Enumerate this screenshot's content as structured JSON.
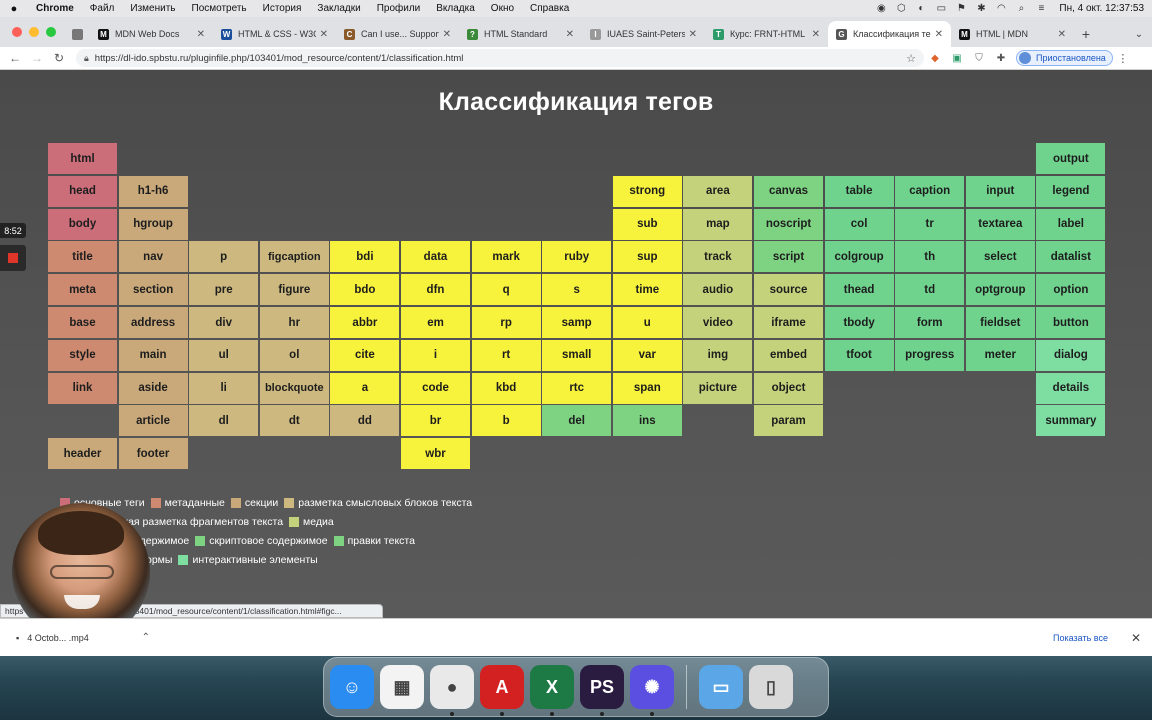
{
  "menubar": {
    "app": "Chrome",
    "items": [
      "Файл",
      "Изменить",
      "Посмотреть",
      "История",
      "Закладки",
      "Профили",
      "Вкладка",
      "Окно",
      "Справка"
    ],
    "clock": "Пн, 4 окт.  12:37:53"
  },
  "tabs": [
    {
      "label": "",
      "fav": "",
      "color": "#777",
      "pinned": true
    },
    {
      "label": "MDN Web Docs",
      "fav": "M",
      "color": "#111"
    },
    {
      "label": "HTML & CSS - W3C",
      "fav": "W",
      "color": "#1a4f9c"
    },
    {
      "label": "Can I use... Support",
      "fav": "C",
      "color": "#8a5a2b"
    },
    {
      "label": "HTML Standard",
      "fav": "?",
      "color": "#3a8a3a"
    },
    {
      "label": "IUAES Saint-Petersb",
      "fav": "I",
      "color": "#999"
    },
    {
      "label": "Курс: FRNT-HTML",
      "fav": "T",
      "color": "#2d9c6a"
    },
    {
      "label": "Классификация тег",
      "fav": "G",
      "color": "#555",
      "active": true
    },
    {
      "label": "HTML | MDN",
      "fav": "M",
      "color": "#111"
    }
  ],
  "toolbar": {
    "url": "https://dl-ido.spbstu.ru/pluginfile.php/103401/mod_resource/content/1/classification.html",
    "paused_label": "Приостановлена"
  },
  "page": {
    "title": "Классификация тегов"
  },
  "colors": {
    "basic": "#cc6e7a",
    "meta": "#cd8a70",
    "sections": "#c9a97a",
    "grouping": "#cdb97f",
    "text": "#f7f23b",
    "media": "#c4d37b",
    "edits": "#7ed383",
    "script": "#7ed383",
    "tables": "#6fd38e",
    "forms": "#6fd38e",
    "interactive": "#7edea2"
  },
  "cells": [
    {
      "tag": "html",
      "cat": "basic",
      "col": 0,
      "row": 0
    },
    {
      "tag": "head",
      "cat": "basic",
      "col": 0,
      "row": 1
    },
    {
      "tag": "body",
      "cat": "basic",
      "col": 0,
      "row": 2
    },
    {
      "tag": "title",
      "cat": "meta",
      "col": 0,
      "row": 3
    },
    {
      "tag": "meta",
      "cat": "meta",
      "col": 0,
      "row": 4
    },
    {
      "tag": "base",
      "cat": "meta",
      "col": 0,
      "row": 5
    },
    {
      "tag": "style",
      "cat": "meta",
      "col": 0,
      "row": 6
    },
    {
      "tag": "link",
      "cat": "meta",
      "col": 0,
      "row": 7
    },
    {
      "tag": "header",
      "cat": "sections",
      "col": 0,
      "row": 9
    },
    {
      "tag": "h1-h6",
      "cat": "sections",
      "col": 1,
      "row": 1
    },
    {
      "tag": "hgroup",
      "cat": "sections",
      "col": 1,
      "row": 2
    },
    {
      "tag": "nav",
      "cat": "sections",
      "col": 1,
      "row": 3
    },
    {
      "tag": "section",
      "cat": "sections",
      "col": 1,
      "row": 4
    },
    {
      "tag": "address",
      "cat": "sections",
      "col": 1,
      "row": 5
    },
    {
      "tag": "main",
      "cat": "sections",
      "col": 1,
      "row": 6
    },
    {
      "tag": "aside",
      "cat": "sections",
      "col": 1,
      "row": 7
    },
    {
      "tag": "article",
      "cat": "sections",
      "col": 1,
      "row": 8
    },
    {
      "tag": "footer",
      "cat": "sections",
      "col": 1,
      "row": 9
    },
    {
      "tag": "p",
      "cat": "grouping",
      "col": 2,
      "row": 3
    },
    {
      "tag": "pre",
      "cat": "grouping",
      "col": 2,
      "row": 4
    },
    {
      "tag": "div",
      "cat": "grouping",
      "col": 2,
      "row": 5
    },
    {
      "tag": "ul",
      "cat": "grouping",
      "col": 2,
      "row": 6
    },
    {
      "tag": "li",
      "cat": "grouping",
      "col": 2,
      "row": 7
    },
    {
      "tag": "dl",
      "cat": "grouping",
      "col": 2,
      "row": 8
    },
    {
      "tag": "figcaption",
      "cat": "grouping",
      "col": 3,
      "row": 3
    },
    {
      "tag": "figure",
      "cat": "grouping",
      "col": 3,
      "row": 4
    },
    {
      "tag": "hr",
      "cat": "grouping",
      "col": 3,
      "row": 5
    },
    {
      "tag": "ol",
      "cat": "grouping",
      "col": 3,
      "row": 6
    },
    {
      "tag": "blockquote",
      "cat": "grouping",
      "col": 3,
      "row": 7
    },
    {
      "tag": "dt",
      "cat": "grouping",
      "col": 3,
      "row": 8
    },
    {
      "tag": "bdi",
      "cat": "text",
      "col": 4,
      "row": 3
    },
    {
      "tag": "bdo",
      "cat": "text",
      "col": 4,
      "row": 4
    },
    {
      "tag": "abbr",
      "cat": "text",
      "col": 4,
      "row": 5
    },
    {
      "tag": "cite",
      "cat": "text",
      "col": 4,
      "row": 6
    },
    {
      "tag": "a",
      "cat": "text",
      "col": 4,
      "row": 7
    },
    {
      "tag": "dd",
      "cat": "grouping",
      "col": 4,
      "row": 8
    },
    {
      "tag": "data",
      "cat": "text",
      "col": 5,
      "row": 3
    },
    {
      "tag": "dfn",
      "cat": "text",
      "col": 5,
      "row": 4
    },
    {
      "tag": "em",
      "cat": "text",
      "col": 5,
      "row": 5
    },
    {
      "tag": "i",
      "cat": "text",
      "col": 5,
      "row": 6
    },
    {
      "tag": "code",
      "cat": "text",
      "col": 5,
      "row": 7
    },
    {
      "tag": "br",
      "cat": "text",
      "col": 5,
      "row": 8
    },
    {
      "tag": "wbr",
      "cat": "text",
      "col": 5,
      "row": 9
    },
    {
      "tag": "mark",
      "cat": "text",
      "col": 6,
      "row": 3
    },
    {
      "tag": "q",
      "cat": "text",
      "col": 6,
      "row": 4
    },
    {
      "tag": "rp",
      "cat": "text",
      "col": 6,
      "row": 5
    },
    {
      "tag": "rt",
      "cat": "text",
      "col": 6,
      "row": 6
    },
    {
      "tag": "kbd",
      "cat": "text",
      "col": 6,
      "row": 7
    },
    {
      "tag": "b",
      "cat": "text",
      "col": 6,
      "row": 8
    },
    {
      "tag": "ruby",
      "cat": "text",
      "col": 7,
      "row": 3
    },
    {
      "tag": "s",
      "cat": "text",
      "col": 7,
      "row": 4
    },
    {
      "tag": "samp",
      "cat": "text",
      "col": 7,
      "row": 5
    },
    {
      "tag": "small",
      "cat": "text",
      "col": 7,
      "row": 6
    },
    {
      "tag": "rtc",
      "cat": "text",
      "col": 7,
      "row": 7
    },
    {
      "tag": "del",
      "cat": "edits",
      "col": 7,
      "row": 8
    },
    {
      "tag": "strong",
      "cat": "text",
      "col": 8,
      "row": 1
    },
    {
      "tag": "sub",
      "cat": "text",
      "col": 8,
      "row": 2
    },
    {
      "tag": "sup",
      "cat": "text",
      "col": 8,
      "row": 3
    },
    {
      "tag": "time",
      "cat": "text",
      "col": 8,
      "row": 4
    },
    {
      "tag": "u",
      "cat": "text",
      "col": 8,
      "row": 5
    },
    {
      "tag": "var",
      "cat": "text",
      "col": 8,
      "row": 6
    },
    {
      "tag": "span",
      "cat": "text",
      "col": 8,
      "row": 7
    },
    {
      "tag": "ins",
      "cat": "edits",
      "col": 8,
      "row": 8
    },
    {
      "tag": "area",
      "cat": "media",
      "col": 9,
      "row": 1
    },
    {
      "tag": "map",
      "cat": "media",
      "col": 9,
      "row": 2
    },
    {
      "tag": "track",
      "cat": "media",
      "col": 9,
      "row": 3
    },
    {
      "tag": "audio",
      "cat": "media",
      "col": 9,
      "row": 4
    },
    {
      "tag": "video",
      "cat": "media",
      "col": 9,
      "row": 5
    },
    {
      "tag": "img",
      "cat": "media",
      "col": 9,
      "row": 6
    },
    {
      "tag": "picture",
      "cat": "media",
      "col": 9,
      "row": 7
    },
    {
      "tag": "canvas",
      "cat": "script",
      "col": 10,
      "row": 1
    },
    {
      "tag": "noscript",
      "cat": "script",
      "col": 10,
      "row": 2
    },
    {
      "tag": "script",
      "cat": "script",
      "col": 10,
      "row": 3
    },
    {
      "tag": "source",
      "cat": "media",
      "col": 10,
      "row": 4
    },
    {
      "tag": "iframe",
      "cat": "media",
      "col": 10,
      "row": 5
    },
    {
      "tag": "embed",
      "cat": "media",
      "col": 10,
      "row": 6
    },
    {
      "tag": "object",
      "cat": "media",
      "col": 10,
      "row": 7
    },
    {
      "tag": "param",
      "cat": "media",
      "col": 10,
      "row": 8
    },
    {
      "tag": "table",
      "cat": "tables",
      "col": 11,
      "row": 1
    },
    {
      "tag": "col",
      "cat": "tables",
      "col": 11,
      "row": 2
    },
    {
      "tag": "colgroup",
      "cat": "tables",
      "col": 11,
      "row": 3
    },
    {
      "tag": "thead",
      "cat": "tables",
      "col": 11,
      "row": 4
    },
    {
      "tag": "tbody",
      "cat": "tables",
      "col": 11,
      "row": 5
    },
    {
      "tag": "tfoot",
      "cat": "tables",
      "col": 11,
      "row": 6
    },
    {
      "tag": "caption",
      "cat": "tables",
      "col": 12,
      "row": 1
    },
    {
      "tag": "tr",
      "cat": "tables",
      "col": 12,
      "row": 2
    },
    {
      "tag": "th",
      "cat": "tables",
      "col": 12,
      "row": 3
    },
    {
      "tag": "td",
      "cat": "tables",
      "col": 12,
      "row": 4
    },
    {
      "tag": "form",
      "cat": "forms",
      "col": 12,
      "row": 5
    },
    {
      "tag": "progress",
      "cat": "forms",
      "col": 12,
      "row": 6
    },
    {
      "tag": "input",
      "cat": "forms",
      "col": 13,
      "row": 1
    },
    {
      "tag": "textarea",
      "cat": "forms",
      "col": 13,
      "row": 2
    },
    {
      "tag": "select",
      "cat": "forms",
      "col": 13,
      "row": 3
    },
    {
      "tag": "optgroup",
      "cat": "forms",
      "col": 13,
      "row": 4
    },
    {
      "tag": "fieldset",
      "cat": "forms",
      "col": 13,
      "row": 5
    },
    {
      "tag": "meter",
      "cat": "forms",
      "col": 13,
      "row": 6
    },
    {
      "tag": "output",
      "cat": "forms",
      "col": 14,
      "row": 0
    },
    {
      "tag": "legend",
      "cat": "forms",
      "col": 14,
      "row": 1
    },
    {
      "tag": "label",
      "cat": "forms",
      "col": 14,
      "row": 2
    },
    {
      "tag": "datalist",
      "cat": "forms",
      "col": 14,
      "row": 3
    },
    {
      "tag": "option",
      "cat": "forms",
      "col": 14,
      "row": 4
    },
    {
      "tag": "button",
      "cat": "forms",
      "col": 14,
      "row": 5
    },
    {
      "tag": "dialog",
      "cat": "interactive",
      "col": 14,
      "row": 6
    },
    {
      "tag": "details",
      "cat": "interactive",
      "col": 14,
      "row": 7
    },
    {
      "tag": "summary",
      "cat": "interactive",
      "col": 14,
      "row": 8
    }
  ],
  "legend": [
    [
      {
        "label": "основные теги",
        "cat": "basic"
      },
      {
        "label": "метаданные",
        "cat": "meta"
      },
      {
        "label": "секции",
        "cat": "sections"
      },
      {
        "label": "разметка смысловых блоков текста",
        "cat": "grouping"
      }
    ],
    [
      {
        "label": "ская разметка фрагментов текста",
        "cat": "text"
      },
      {
        "label": "медиа",
        "cat": "media"
      }
    ],
    [
      {
        "label": "одержимое",
        "cat": "tables"
      },
      {
        "label": "скриптовое содержимое",
        "cat": "script"
      },
      {
        "label": "правки текста",
        "cat": "edits"
      }
    ],
    [
      {
        "label": "ормы",
        "cat": "forms"
      },
      {
        "label": "интерактивные элементы",
        "cat": "interactive"
      }
    ]
  ],
  "recording": {
    "time": "8:52"
  },
  "status_url": "https://dl-ido.spbstu.ru/pluginfile.php/103401/mod_resource/content/1/classification.html#figc...",
  "status_prefix": "https",
  "status_suffix": "hp/103401/mod_resource/content/1/classification.html#figc...",
  "download": {
    "file": "4 Octob... .mp4",
    "show_all": "Показать все"
  },
  "dock": [
    {
      "name": "finder",
      "glyph": "☺",
      "color": "#2a8cf0"
    },
    {
      "name": "launchpad",
      "glyph": "▦",
      "color": "#f3f3f3"
    },
    {
      "name": "chrome",
      "glyph": "●",
      "color": "#e9e9e9"
    },
    {
      "name": "acrobat",
      "glyph": "A",
      "color": "#d32020"
    },
    {
      "name": "excel",
      "glyph": "X",
      "color": "#1d7a44"
    },
    {
      "name": "phpstorm",
      "glyph": "PS",
      "color": "#2a1b40"
    },
    {
      "name": "app",
      "glyph": "✺",
      "color": "#5a4fe0"
    },
    {
      "name": "folder",
      "glyph": "▭",
      "color": "#5aa6e6"
    },
    {
      "name": "trash",
      "glyph": "▯",
      "color": "#d9d9d9"
    }
  ]
}
